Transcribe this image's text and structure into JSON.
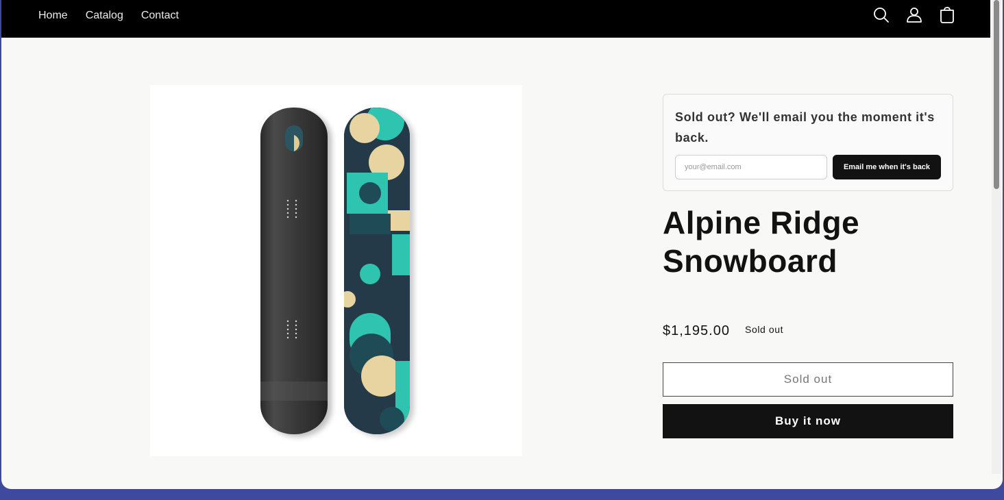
{
  "nav": {
    "items": [
      {
        "label": "Home"
      },
      {
        "label": "Catalog"
      },
      {
        "label": "Contact"
      }
    ]
  },
  "header_icons": [
    "search-icon",
    "account-icon",
    "cart-icon"
  ],
  "notify": {
    "title": "Sold out? We'll email you the moment it's back.",
    "email_placeholder": "your@email.com",
    "button_label": "Email me when it's back"
  },
  "product": {
    "title": "Alpine Ridge Snowboard",
    "price": "$1,195.00",
    "badge": "Sold out",
    "soldout_button": "Sold out",
    "buy_button": "Buy it now",
    "image_alt": "Snowboard image"
  },
  "colors": {
    "header_bg": "#000000",
    "page_bg": "#f8f8f7",
    "button_dark": "#121212",
    "teal": "#2ec4b0",
    "cream": "#e8d4a0",
    "navy": "#243a48"
  }
}
